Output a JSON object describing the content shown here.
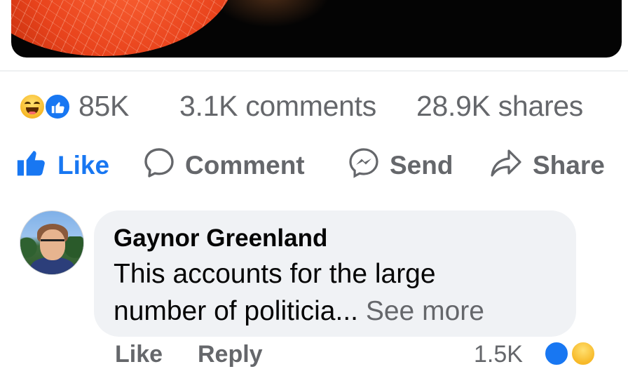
{
  "post": {
    "reactions": {
      "icons": [
        "haha-icon",
        "like-icon"
      ],
      "count": "85K"
    },
    "comments_count": "3.1K comments",
    "shares_count": "28.9K shares"
  },
  "actions": {
    "like": "Like",
    "comment": "Comment",
    "send": "Send",
    "share": "Share"
  },
  "comment": {
    "author": "Gaynor Greenland",
    "text_line1": "This accounts for the large",
    "text_line2": "number of politicia...",
    "see_more": " See more",
    "footer": {
      "like": "Like",
      "reply": "Reply",
      "reaction_count": "1.5K"
    }
  },
  "colors": {
    "accent": "#1877f2",
    "muted": "#65676b",
    "bubble": "#f0f2f5"
  }
}
